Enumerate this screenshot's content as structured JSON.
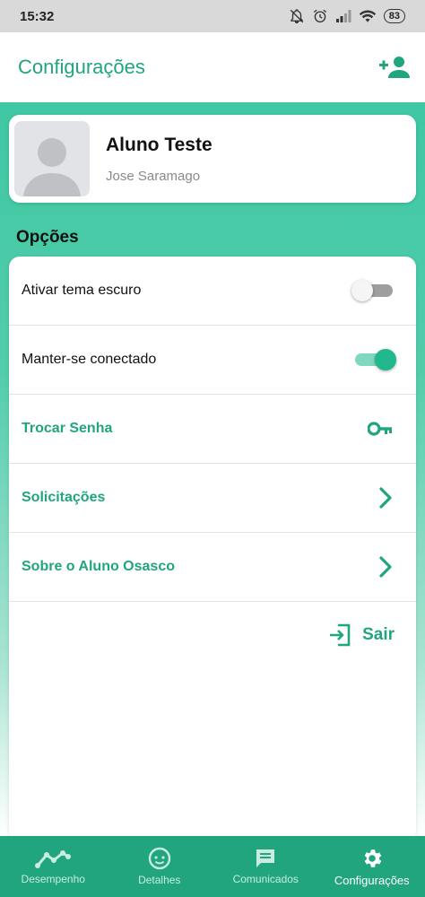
{
  "status_bar": {
    "time": "15:32",
    "battery": "83"
  },
  "app_bar": {
    "title": "Configurações",
    "add_user_icon": "person-add-icon"
  },
  "profile": {
    "name": "Aluno Teste",
    "subtitle": "Jose Saramago",
    "avatar_icon": "person-placeholder-icon"
  },
  "options": {
    "section_title": "Opções",
    "items": [
      {
        "label": "Ativar tema escuro",
        "control": "toggle",
        "on": false
      },
      {
        "label": "Manter-se conectado",
        "control": "toggle",
        "on": true
      },
      {
        "label": "Trocar Senha",
        "control": "key-icon"
      },
      {
        "label": "Solicitações",
        "control": "chevron-right-icon"
      },
      {
        "label": "Sobre o Aluno Osasco",
        "control": "chevron-right-icon"
      }
    ],
    "logout_label": "Sair"
  },
  "bottom_nav": {
    "items": [
      {
        "label": "Desempenho",
        "icon": "chart-line-icon",
        "active": false
      },
      {
        "label": "Detalhes",
        "icon": "face-icon",
        "active": false
      },
      {
        "label": "Comunicados",
        "icon": "message-icon",
        "active": false
      },
      {
        "label": "Configurações",
        "icon": "gear-icon",
        "active": true
      }
    ]
  },
  "colors": {
    "accent": "#20a57e",
    "bottom_nav_bg": "#20a57e",
    "gradient_top": "#3fc7a3"
  }
}
